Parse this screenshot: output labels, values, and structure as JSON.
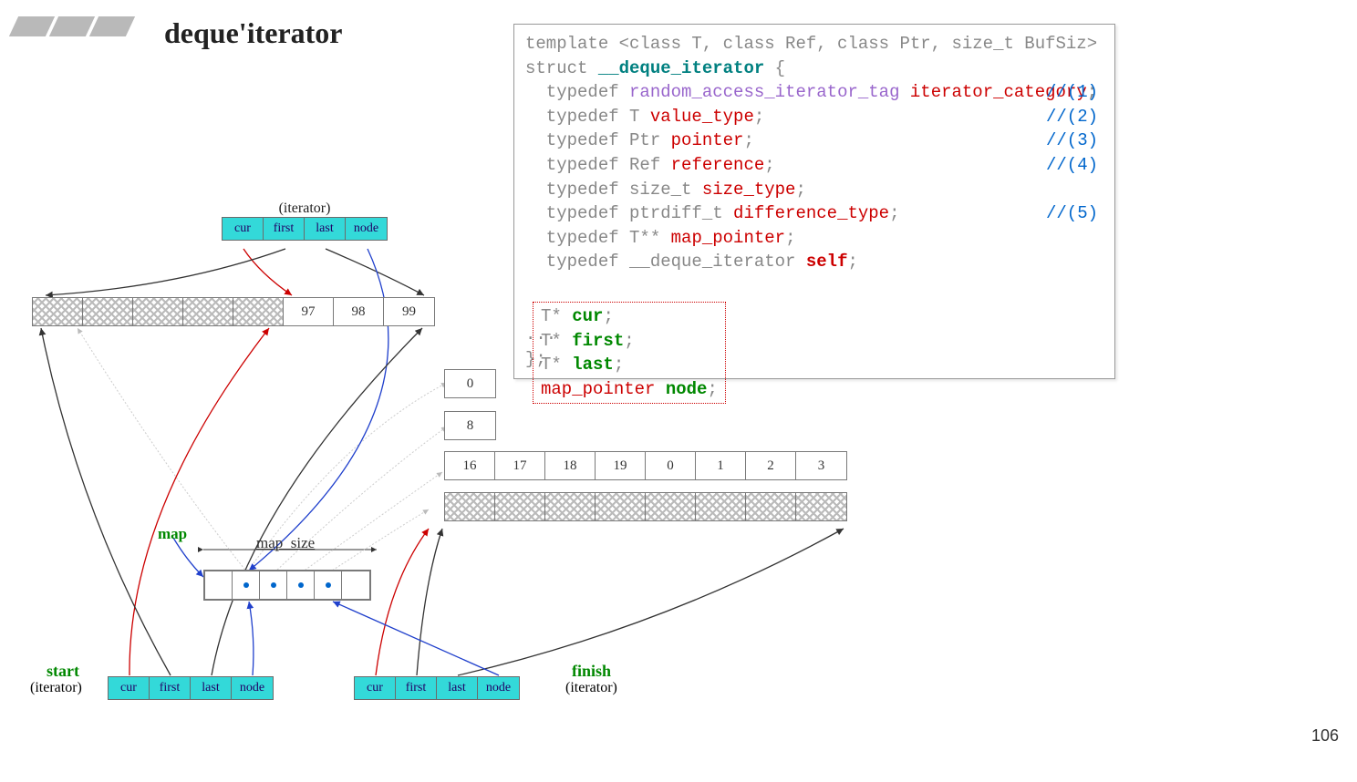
{
  "title": "deque'iterator",
  "page_number": "106",
  "code": {
    "line1": "template <class T, class Ref, class Ptr, size_t BufSiz>",
    "line2a": "struct ",
    "line2b": "__deque_iterator",
    "line2c": " {",
    "t1a": "  typedef ",
    "t1b": "random_access_iterator_tag ",
    "t1c": "iterator_category",
    "c1": "//(1)",
    "t2a": "  typedef T ",
    "t2c": "value_type",
    "c2": "//(2)",
    "t3a": "  typedef Ptr ",
    "t3c": "pointer",
    "c3": "//(3)",
    "t4a": "  typedef Ref ",
    "t4c": "reference",
    "c4": "//(4)",
    "t5a": "  typedef size_t ",
    "t5c": "size_type",
    "t6a": "  typedef ptrdiff_t ",
    "t6c": "difference_type",
    "c5": "//(5)",
    "t7a": "  typedef T** ",
    "t7c": "map_pointer",
    "t8a": "  typedef __deque_iterator ",
    "t8c": "self",
    "m1a": "T* ",
    "m1b": "cur",
    "m2a": "T* ",
    "m2b": "first",
    "m3a": "T* ",
    "m3b": "last",
    "m4a": "map_pointer ",
    "m4b": "node",
    "dots": "...",
    "close": "};",
    "semi": ";"
  },
  "diagram": {
    "iter_fields": [
      "cur",
      "first",
      "last",
      "node"
    ],
    "top_iter_label": "(iterator)",
    "start_label": "start",
    "finish_label": "finish",
    "iter_sublabel": "(iterator)",
    "map_label": "map",
    "map_size_label": "map_size",
    "buf1": [
      "",
      "",
      "",
      "",
      "",
      "97",
      "98",
      "99"
    ],
    "buf2_col": [
      "0",
      "8"
    ],
    "buf2_row": [
      "16",
      "17",
      "18",
      "19",
      "0",
      "1",
      "2",
      "3"
    ],
    "buf3": [
      "",
      "",
      "",
      "",
      "",
      "",
      "",
      ""
    ]
  }
}
